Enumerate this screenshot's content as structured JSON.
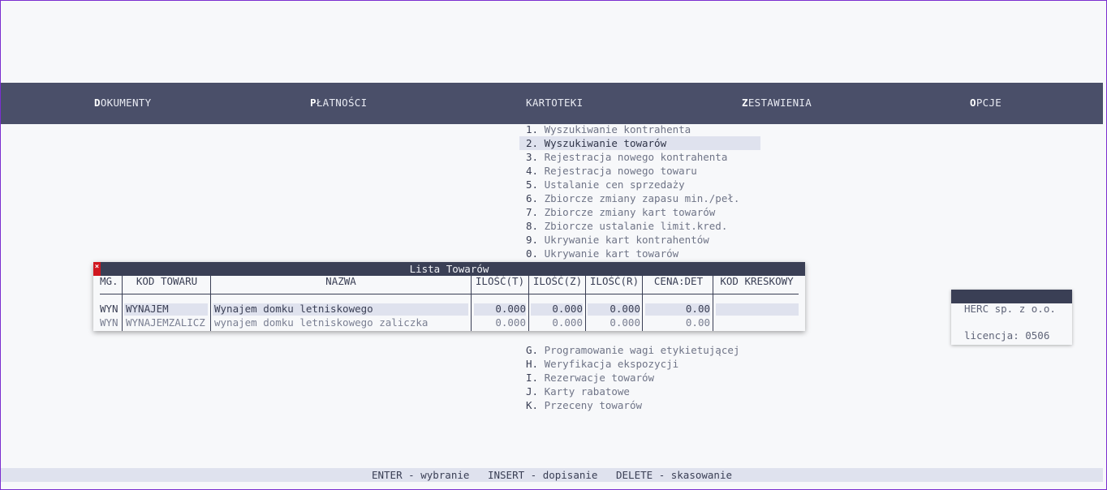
{
  "menubar": [
    {
      "hot": "D",
      "rest": "OKUMENTY"
    },
    {
      "hot": "P",
      "rest": "ŁATNOŚCI"
    },
    {
      "hot": "",
      "rest": "KARTOTEKI"
    },
    {
      "hot": "Z",
      "rest": "ESTAWIENIA"
    },
    {
      "hot": "O",
      "rest": "PCJE"
    }
  ],
  "dropdown": {
    "items": [
      {
        "key": "1.",
        "label": "Wyszukiwanie kontrahenta"
      },
      {
        "key": "2.",
        "label": "Wyszukiwanie towarów"
      },
      {
        "key": "3.",
        "label": "Rejestracja nowego kontrahenta"
      },
      {
        "key": "4.",
        "label": "Rejestracja nowego towaru"
      },
      {
        "key": "5.",
        "label": "Ustalanie cen sprzedaży"
      },
      {
        "key": "6.",
        "label": "Zbiorcze zmiany zapasu min./peł."
      },
      {
        "key": "7.",
        "label": "Zbiorcze zmiany kart towarów"
      },
      {
        "key": "8.",
        "label": "Zbiorcze ustalanie limit.kred."
      },
      {
        "key": "9.",
        "label": "Ukrywanie kart kontrahentów"
      },
      {
        "key": "0.",
        "label": "Ukrywanie kart towarów"
      }
    ],
    "items_lower": [
      {
        "key": "G.",
        "label": "Programowanie wagi etykietującej"
      },
      {
        "key": "H.",
        "label": "Weryfikacja ekspozycji"
      },
      {
        "key": "I.",
        "label": "Rezerwacje towarów"
      },
      {
        "key": "J.",
        "label": "Karty rabatowe"
      },
      {
        "key": "K.",
        "label": "Przeceny towarów"
      }
    ],
    "selected_index": 1
  },
  "window": {
    "title": "Lista Towarów",
    "close_glyph": "×",
    "columns": [
      "MG.",
      "KOD TOWARU",
      "NAZWA",
      "ILOŚĆ(T)",
      "ILOŚĆ(Z)",
      "ILOŚĆ(R)",
      "CENA:DET",
      "KOD KRESKOWY"
    ],
    "rows": [
      {
        "mg": "WYN",
        "kod": "WYNAJEM",
        "nazwa": "Wynajem domku letniskowego",
        "ilosc_t": "0.000",
        "ilosc_z": "0.000",
        "ilosc_r": "0.000",
        "cena": "0.00",
        "kreskowy": ""
      },
      {
        "mg": "WYN",
        "kod": "WYNAJEMZALICZ",
        "nazwa": "wynajem domku letniskowego zaliczka",
        "ilosc_t": "0.000",
        "ilosc_z": "0.000",
        "ilosc_r": "0.000",
        "cena": "0.00",
        "kreskowy": ""
      }
    ]
  },
  "info": {
    "company": "HERC sp. z o.o.",
    "license": "licencja: 0506"
  },
  "statusbar": {
    "text": "ENTER - wybranie   INSERT - dopisanie   DELETE - skasowanie"
  }
}
